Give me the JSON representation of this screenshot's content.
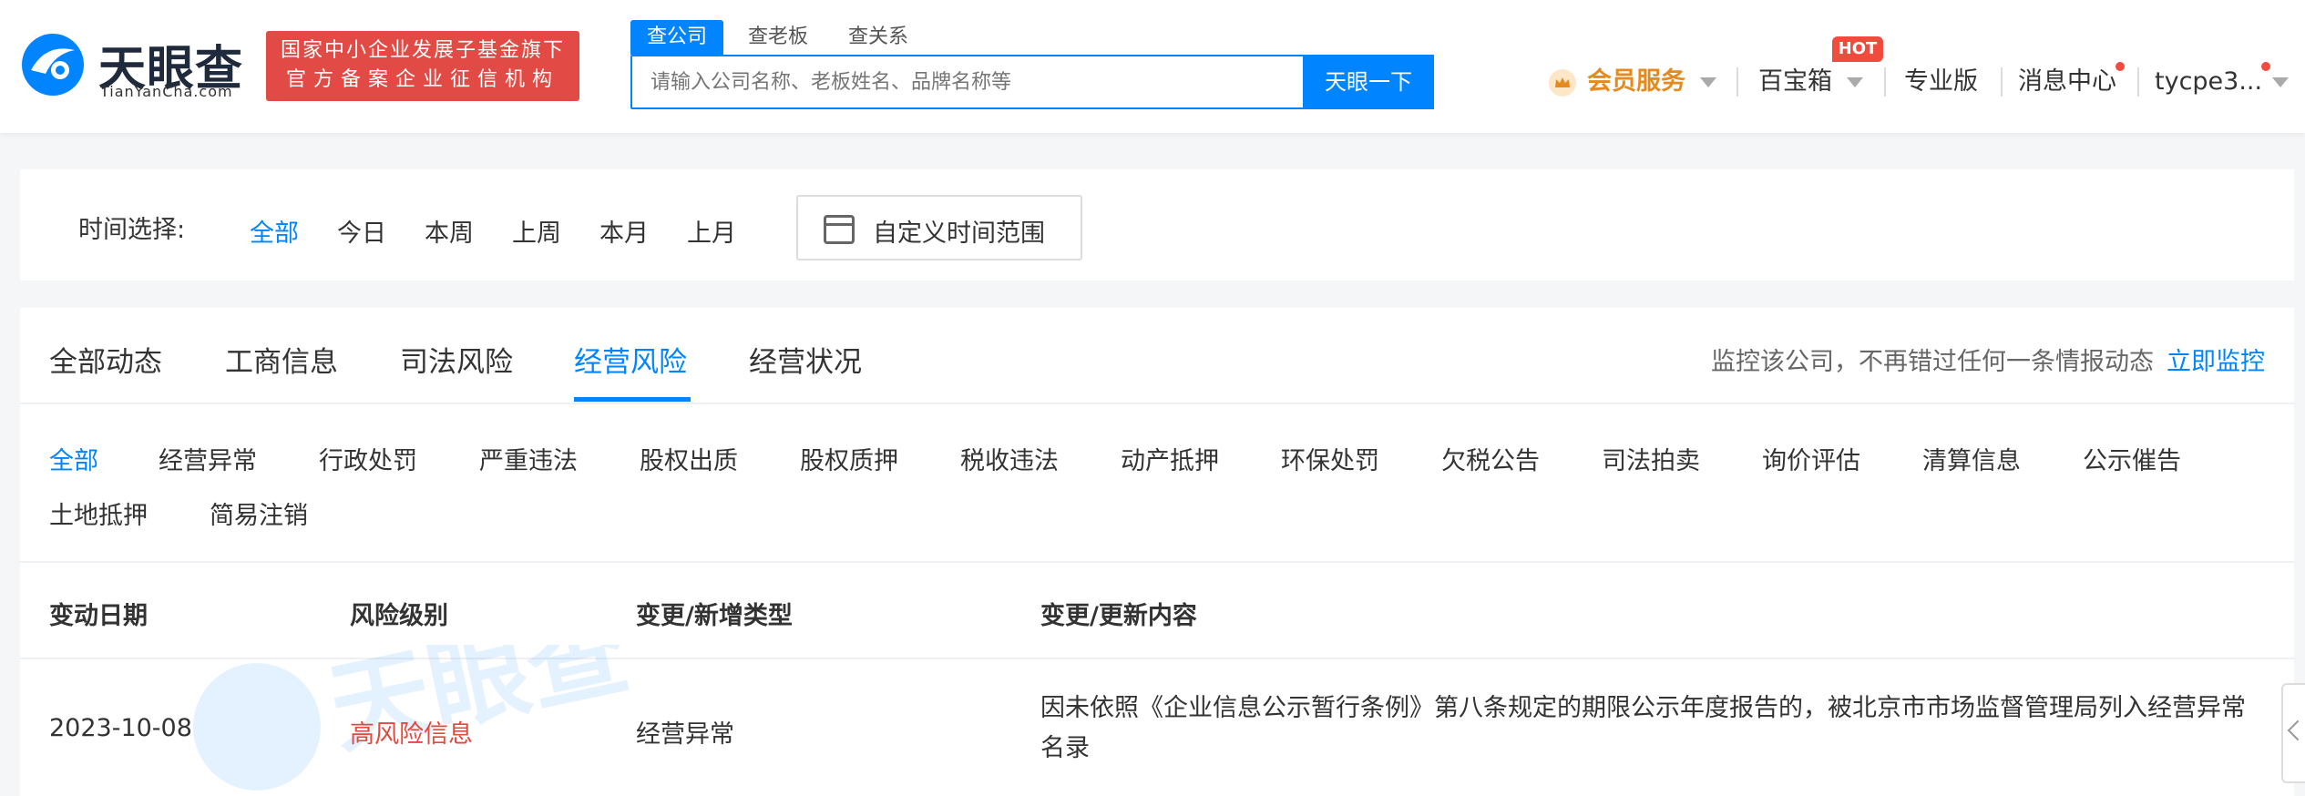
{
  "brand": {
    "name_cn": "天眼查",
    "name_en": "TianYanCha.com",
    "badge_line1": "国家中小企业发展子基金旗下",
    "badge_line2": "官方备案企业征信机构"
  },
  "search": {
    "tabs": [
      "查公司",
      "查老板",
      "查关系"
    ],
    "placeholder": "请输入公司名称、老板姓名、品牌名称等",
    "button": "天眼一下"
  },
  "nav": {
    "vip": "会员服务",
    "toolbox": "百宝箱",
    "hot": "HOT",
    "pro": "专业版",
    "messages": "消息中心",
    "user": "tycpe3..."
  },
  "time_filter": {
    "label": "时间选择:",
    "options": [
      "全部",
      "今日",
      "本周",
      "上周",
      "本月",
      "上月"
    ],
    "custom": "自定义时间范围"
  },
  "main_tabs": [
    "全部动态",
    "工商信息",
    "司法风险",
    "经营风险",
    "经营状况"
  ],
  "monitor": {
    "text": "监控该公司，不再错过任何一条情报动态",
    "link": "立即监控"
  },
  "sub_tabs": [
    "全部",
    "经营异常",
    "行政处罚",
    "严重违法",
    "股权出质",
    "股权质押",
    "税收违法",
    "动产抵押",
    "环保处罚",
    "欠税公告",
    "司法拍卖",
    "询价评估",
    "清算信息",
    "公示催告",
    "土地抵押",
    "简易注销"
  ],
  "table": {
    "headers": [
      "变动日期",
      "风险级别",
      "变更/新增类型",
      "变更/更新内容"
    ],
    "rows": [
      {
        "date": "2023-10-08",
        "risk": "高风险信息",
        "type": "经营异常",
        "content": "因未依照《企业信息公示暂行条例》第八条规定的期限公示年度报告的，被北京市市场监督管理局列入经营异常名录"
      }
    ]
  },
  "colors": {
    "accent": "#0084ff",
    "risk": "#e04a3f",
    "vip": "#e58a1f",
    "badge": "#e24a45"
  }
}
